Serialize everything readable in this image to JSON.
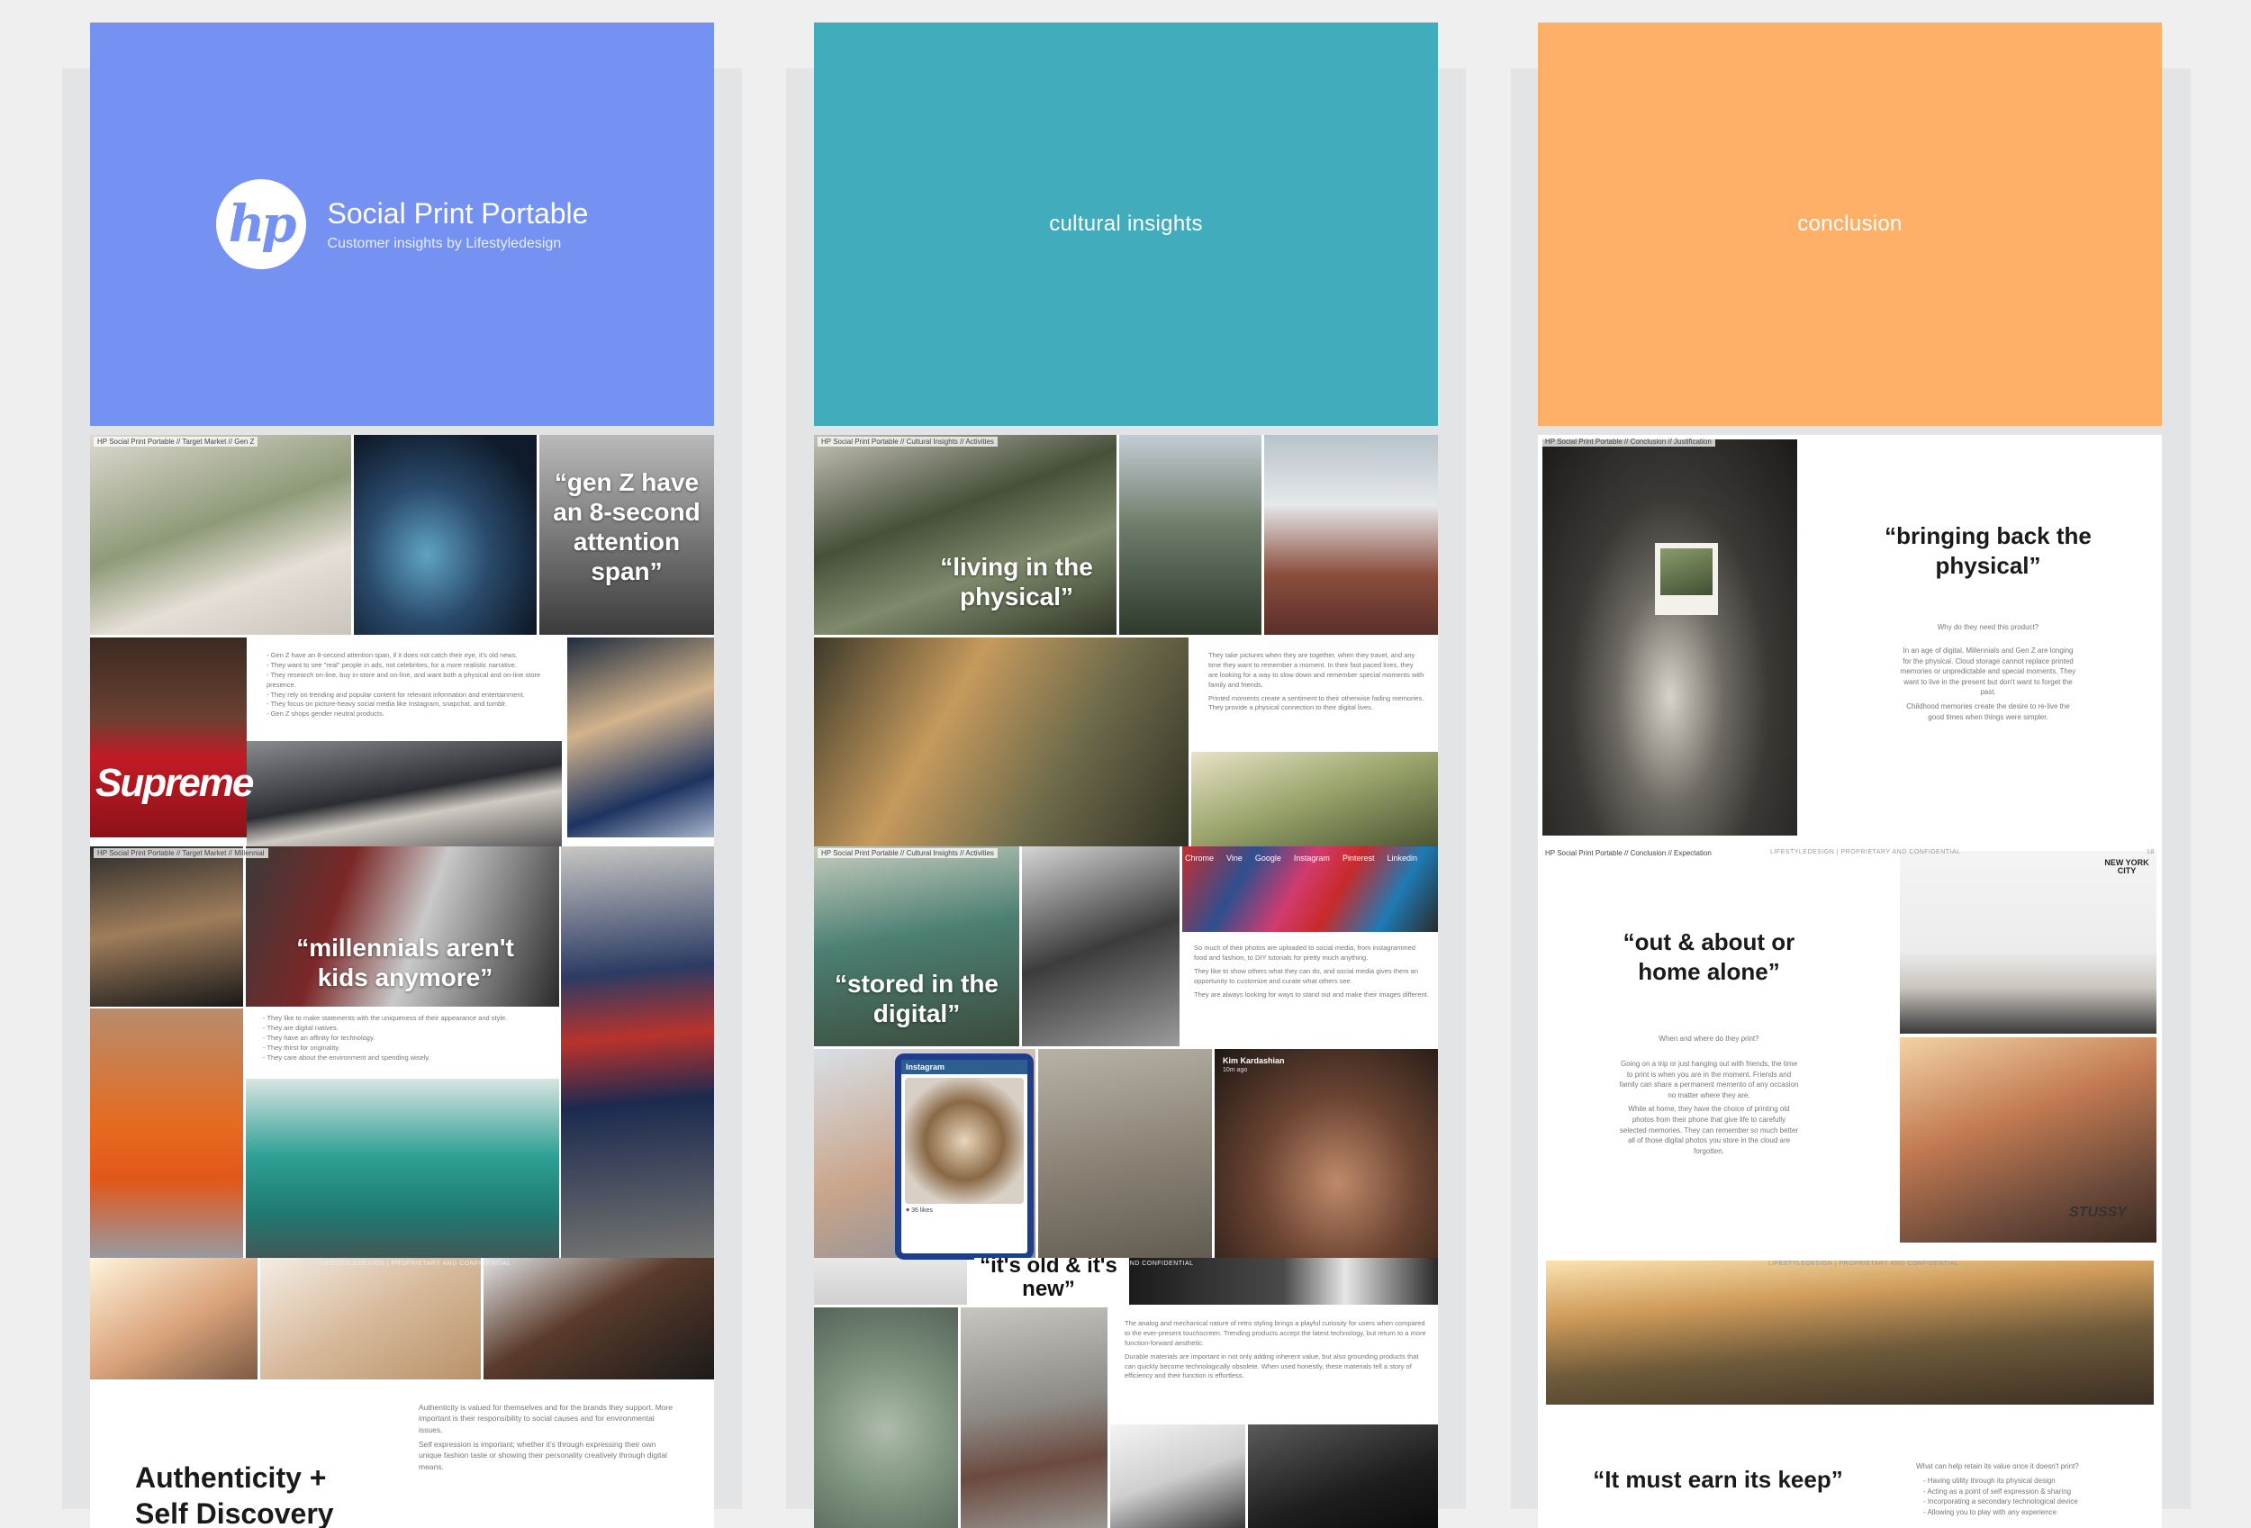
{
  "colors": {
    "cover_blue": "#7592f2",
    "cover_teal": "#41acbb",
    "cover_orange": "#ffb068",
    "background": "#efeff0"
  },
  "cover1": {
    "logo": "hp",
    "title": "Social Print Portable",
    "subtitle": "Customer insights by Lifestyledesign"
  },
  "cover2": {
    "title": "cultural insights"
  },
  "cover3": {
    "title": "conclusion"
  },
  "genz": {
    "header": "HP Social Print Portable // Target Market // Gen Z",
    "quote": "“gen Z have an 8-second attention span”",
    "brand_text": "Supreme",
    "bullets": [
      "Gen Z have an 8-second attention span, if it does not catch their eye, it's old news.",
      "They want to see \"real\" people in ads, not celebrities, for a more realistic narrative.",
      "They research on-line, buy in-store and on-line, and want both a physical and on-line store presence.",
      "They rely on trending and popular content for relevant information and entertainment.",
      "They focus on picture-heavy social media like Instagram, snapchat, and tumblr.",
      "Gen Z shops gender neutral products."
    ]
  },
  "millennials": {
    "header": "HP Social Print Portable // Target Market // Millennial",
    "quote": "“millennials aren't kids anymore”",
    "bullets": [
      "They like to make statements with the uniqueness of their appearance and style.",
      "They are digital natives.",
      "They have an affinity for technology.",
      "They thirst for originality.",
      "They care about the environment and spending wisely."
    ],
    "footer": "LIFESTYLEDESIGN | PROPRIETARY AND CONFIDENTIAL"
  },
  "authenticity": {
    "title": "Authenticity + Self Discovery",
    "paragraphs": [
      "Authenticity is valued for themselves and for the brands they support. More important is their responsibility to social causes and for environmental issues.",
      "Self expression is important; whether it's through expressing their own unique fashion taste or showing their personality creatively through digital means."
    ]
  },
  "living": {
    "header": "HP Social Print Portable // Cultural Insights // Activities",
    "quote": "“living in the physical”",
    "paragraphs": [
      "They take pictures when they are together, when they travel, and any time they want to remember a moment. In their fast paced lives, they are looking for a way to slow down and remember special moments with family and friends.",
      "Printed moments create a sentiment to their otherwise fading memories. They provide a physical connection to their digital lives."
    ]
  },
  "stored": {
    "header": "HP Social Print Portable // Cultural Insights // Activities",
    "quote": "“stored in the digital”",
    "app_labels": [
      "Chrome",
      "Vine",
      "Google",
      "Instagram",
      "Pinterest",
      "Linkedin"
    ],
    "paragraphs": [
      "So much of their photos are uploaded to social media, from instagrammed food and fashion, to DIY tutorials for pretty much anything.",
      "They like to show others what they can do, and social media gives them an opportunity to customize and curate what others see.",
      "They are always looking for ways to stand out and make their images different."
    ],
    "phone_header": "Instagram",
    "phone_likes": "♥ 36 likes",
    "story_name": "Kim Kardashian",
    "story_time": "10m ago",
    "footer": "LIFESTYLEDESIGN | PROPRIETARY AND CONFIDENTIAL"
  },
  "oldnew": {
    "quote": "“it's old & it's new”",
    "paragraphs": [
      "The analog and mechanical nature of retro styling brings a playful curiosity for users when compared to the ever-present touchscreen. Trending products accept the latest technology, but return to a more function-forward aesthetic.",
      "Durable materials are important in not only adding inherent value, but also grounding products that can quickly become technologically obsolete. When used honestly, these materials tell a story of efficiency and their function is effortless."
    ]
  },
  "bringing": {
    "header": "HP Social Print Portable // Conclusion // Justification",
    "quote": "“bringing back the physical”",
    "question": "Why do they need this product?",
    "paragraphs": [
      "In an age of digital, Millennials and Gen Z are longing for the physical. Cloud storage cannot replace printed memories or unpredictable and special moments. They want to live in the present but don't want to forget the past.",
      "Childhood memories create the desire to re-live the good times when things were simpler."
    ],
    "footer": "LIFESTYLEDESIGN | PROPRIETARY AND CONFIDENTIAL",
    "page": "18"
  },
  "outabout": {
    "header": "HP Social Print Portable // Conclusion // Expectation",
    "quote": "“out & about or home alone”",
    "question": "When and where do they print?",
    "paragraphs": [
      "Going on a trip or just hanging out with friends, the time to print is when you are in the moment. Friends and family can share a permanent memento of any occasion no matter where they are.",
      "While at home, they have the choice of printing old photos from their phone that give life to carefully selected memories. They can remember so much better all of those digital photos you store in the cloud are forgotten."
    ],
    "shirt_text": "STUSSY",
    "sign_text": "NEW YORK CITY",
    "footer": "LIFESTYLEDESIGN | PROPRIETARY AND CONFIDENTIAL"
  },
  "earn": {
    "quote": "“It must earn its keep”",
    "question": "What can help retain its value once it doesn't print?",
    "bullets": [
      "Having utility through its physical design",
      "Acting as a point of self expression & sharing",
      "Incorporating a secondary technological device",
      "Allowing you to play with any experience"
    ]
  }
}
